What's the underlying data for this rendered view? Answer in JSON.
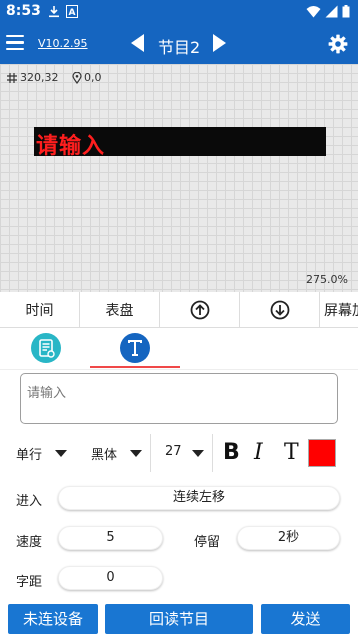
{
  "status_bar": {
    "time": "8:53",
    "icons_left": [
      "download-icon",
      "font-a-icon"
    ],
    "icons_right": [
      "wifi-icon",
      "signal-icon",
      "battery-icon"
    ]
  },
  "app_bar": {
    "version": "V10.2.95",
    "program_title": "节目2",
    "bg_color": "#1565c0"
  },
  "canvas": {
    "coords": "320,32",
    "position": "0,0",
    "led_text": "请输入",
    "led_text_color": "#ff1e1e",
    "zoom": "275.0%"
  },
  "function_tabs": {
    "time": "时间",
    "dial": "表盘",
    "up_icon": "circle-arrow-up-icon",
    "down_icon": "circle-arrow-down-icon",
    "screen": "屏幕加"
  },
  "mode_tabs": [
    {
      "name": "doc-mode",
      "icon": "document-icon",
      "active": false
    },
    {
      "name": "text-mode",
      "icon": "text-t-icon",
      "active": true
    }
  ],
  "text_input": {
    "placeholder": "请输入",
    "value": ""
  },
  "format": {
    "line_mode": "单行",
    "font": "黑体",
    "size": "27",
    "bold": "B",
    "italic": "I",
    "text_style": "T",
    "color": "#ff0000"
  },
  "params": {
    "enter_label": "进入",
    "enter_value": "连续左移",
    "speed_label": "速度",
    "speed_value": "5",
    "stay_label": "停留",
    "stay_value": "2秒",
    "spacing_label": "字距",
    "spacing_value": "0"
  },
  "bottom_buttons": {
    "device": "未连设备",
    "readback": "回读节目",
    "send": "发送"
  }
}
